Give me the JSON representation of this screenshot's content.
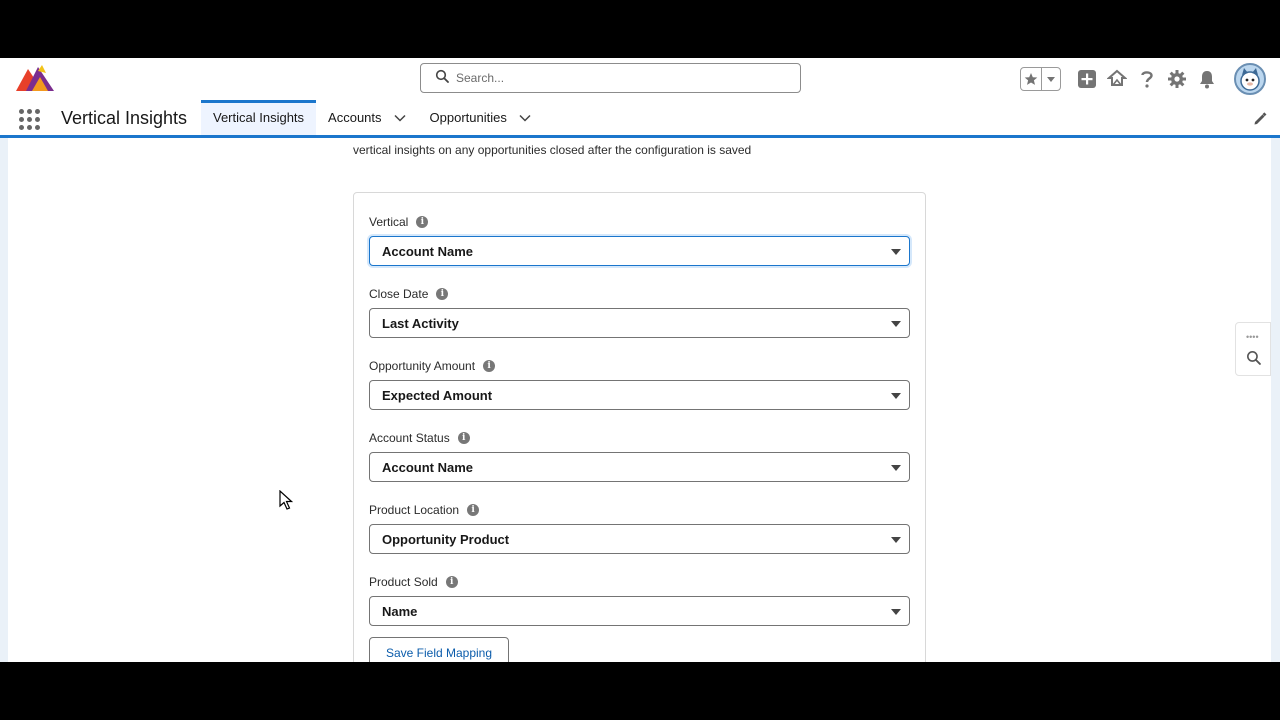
{
  "header": {
    "search_placeholder": "Search...",
    "icons": [
      "favorites-star-icon",
      "favorites-list-icon",
      "global-add-icon",
      "trailhead-icon",
      "help-icon",
      "setup-gear-icon",
      "notifications-bell-icon",
      "user-avatar"
    ]
  },
  "nav": {
    "app_name": "Vertical Insights",
    "tabs": [
      {
        "label": "Vertical Insights",
        "active": true,
        "dropdown": false
      },
      {
        "label": "Accounts",
        "active": false,
        "dropdown": true
      },
      {
        "label": "Opportunities",
        "active": false,
        "dropdown": true
      }
    ]
  },
  "intro_text": "vertical insights on any opportunities closed after the configuration is saved",
  "form": {
    "fields": [
      {
        "label": "Vertical",
        "value": "Account Name"
      },
      {
        "label": "Close Date",
        "value": "Last Activity"
      },
      {
        "label": "Opportunity Amount",
        "value": "Expected Amount"
      },
      {
        "label": "Account Status",
        "value": "Account Name"
      },
      {
        "label": "Product Location",
        "value": "Opportunity Product"
      },
      {
        "label": "Product Sold",
        "value": "Name"
      }
    ],
    "save_label": "Save Field Mapping"
  },
  "colors": {
    "brand_blue": "#1b76cc",
    "link_blue": "#0b5cab",
    "page_bg": "#eaf1f8"
  }
}
